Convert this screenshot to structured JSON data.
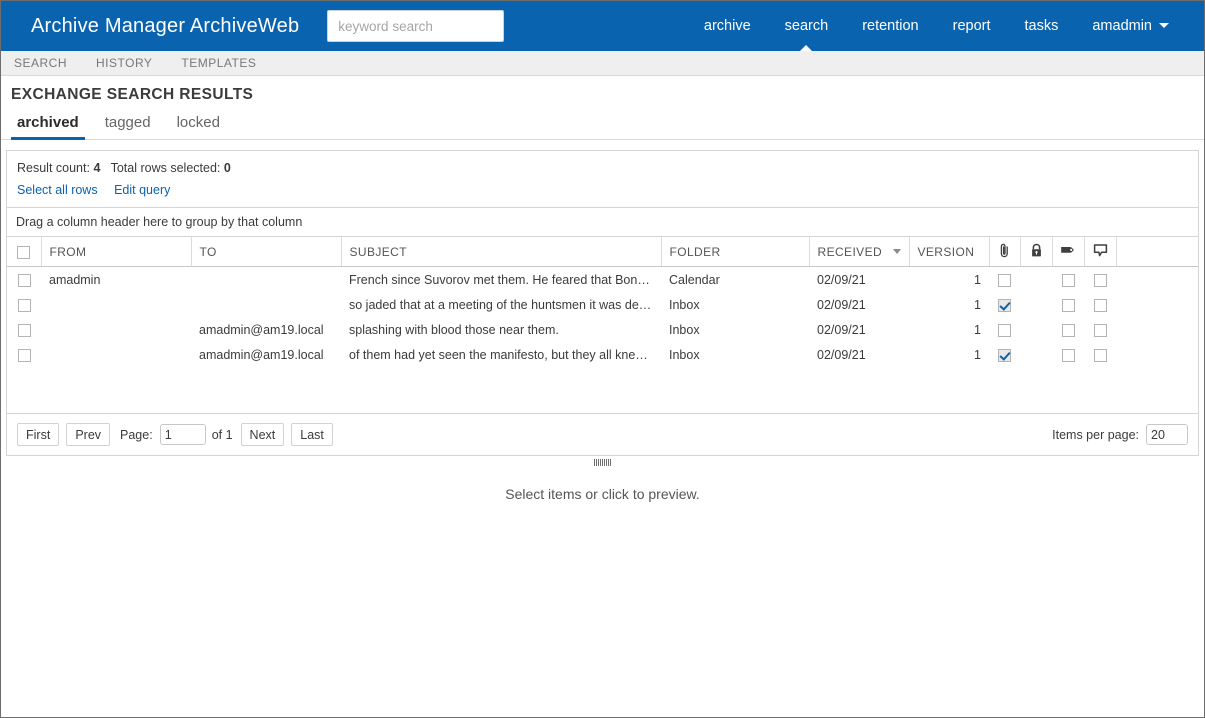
{
  "header": {
    "brand": "Archive Manager ArchiveWeb",
    "search": {
      "placeholder": "keyword search",
      "value": ""
    },
    "nav": [
      {
        "label": "archive",
        "active": false
      },
      {
        "label": "search",
        "active": true
      },
      {
        "label": "retention",
        "active": false
      },
      {
        "label": "report",
        "active": false
      },
      {
        "label": "tasks",
        "active": false
      }
    ],
    "user": "amadmin",
    "brand_color": "#0a63ae"
  },
  "subnav": {
    "items": [
      {
        "label": "SEARCH"
      },
      {
        "label": "HISTORY"
      },
      {
        "label": "TEMPLATES"
      }
    ]
  },
  "page": {
    "title": "EXCHANGE SEARCH RESULTS"
  },
  "state_tabs": [
    {
      "label": "archived",
      "active": true
    },
    {
      "label": "tagged",
      "active": false
    },
    {
      "label": "locked",
      "active": false
    }
  ],
  "results": {
    "result_count_label": "Result count:",
    "result_count": "4",
    "total_selected_label": "Total rows selected:",
    "total_selected": "0",
    "links": [
      {
        "label": "Select all rows"
      },
      {
        "label": "Edit query"
      }
    ],
    "group_hint": "Drag a column header here to group by that column"
  },
  "grid": {
    "columns": [
      {
        "key": "select",
        "label": "",
        "type": "checkbox-header"
      },
      {
        "key": "from",
        "label": "FROM",
        "type": "text"
      },
      {
        "key": "to",
        "label": "TO",
        "type": "text"
      },
      {
        "key": "subject",
        "label": "SUBJECT",
        "type": "text"
      },
      {
        "key": "folder",
        "label": "FOLDER",
        "type": "text"
      },
      {
        "key": "received",
        "label": "RECEIVED",
        "type": "text",
        "sorted": "desc"
      },
      {
        "key": "version",
        "label": "VERSION",
        "type": "text"
      },
      {
        "key": "attachment",
        "label": "",
        "type": "icon",
        "icon": "paperclip-icon"
      },
      {
        "key": "locked",
        "label": "",
        "type": "icon",
        "icon": "lock-icon"
      },
      {
        "key": "tag",
        "label": "",
        "type": "icon",
        "icon": "tag-icon"
      },
      {
        "key": "note",
        "label": "",
        "type": "icon",
        "icon": "comment-icon"
      },
      {
        "key": "spacer",
        "label": "",
        "type": "spacer"
      }
    ],
    "rows": [
      {
        "select": false,
        "from": "amadmin",
        "to": "",
        "subject": "French since Suvorov met them. He feared that Bonapart...",
        "folder": "Calendar",
        "received": "02/09/21",
        "version": "1",
        "attachment": false,
        "tag": false,
        "note": false
      },
      {
        "select": false,
        "from": "",
        "to": "",
        "subject": "so jaded that at a meeting of the huntsmen it was decide...",
        "folder": "Inbox",
        "received": "02/09/21",
        "version": "1",
        "attachment": true,
        "tag": false,
        "note": false
      },
      {
        "select": false,
        "from": "",
        "to": "amadmin@am19.local",
        "subject": "splashing with blood those near them.",
        "folder": "Inbox",
        "received": "02/09/21",
        "version": "1",
        "attachment": false,
        "tag": false,
        "note": false
      },
      {
        "select": false,
        "from": "",
        "to": "amadmin@am19.local",
        "subject": "of them had yet seen the manifesto, but they all knew it ...",
        "folder": "Inbox",
        "received": "02/09/21",
        "version": "1",
        "attachment": true,
        "tag": false,
        "note": false
      }
    ]
  },
  "pager": {
    "first": "First",
    "prev": "Prev",
    "page_label": "Page:",
    "page_value": "1",
    "of_label": "of 1",
    "next": "Next",
    "last": "Last",
    "items_per_page_label": "Items per page:",
    "items_per_page_value": "20"
  },
  "preview": {
    "message": "Select items or click to preview."
  }
}
